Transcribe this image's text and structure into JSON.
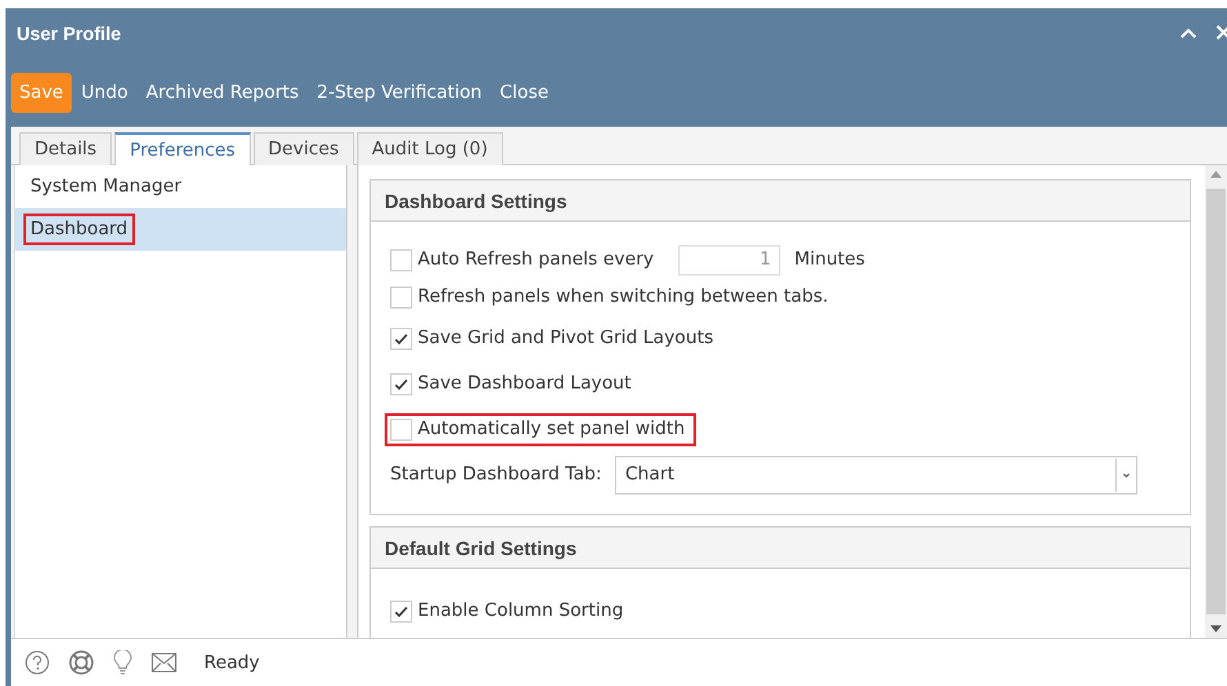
{
  "window": {
    "title": "User Profile"
  },
  "toolbar": [
    {
      "label": "Save",
      "kind": "primary"
    },
    {
      "label": "Undo",
      "kind": "plain"
    },
    {
      "label": "Archived Reports",
      "kind": "plain"
    },
    {
      "label": "2-Step Verification",
      "kind": "plain"
    },
    {
      "label": "Close",
      "kind": "plain"
    }
  ],
  "tabs": [
    {
      "label": "Details",
      "selected": false
    },
    {
      "label": "Preferences",
      "selected": true
    },
    {
      "label": "Devices",
      "selected": false
    },
    {
      "label": "Audit Log (0)",
      "selected": false
    }
  ],
  "sidebar": {
    "items": [
      {
        "label": "System Manager",
        "selected": false,
        "highlighted": false
      },
      {
        "label": "Dashboard",
        "selected": true,
        "highlighted": true
      }
    ]
  },
  "sections": [
    {
      "title": "Dashboard Settings",
      "rows": [
        {
          "kind": "checkbox-number",
          "label": "Auto Refresh panels every",
          "checked": false,
          "value": "1",
          "unit": "Minutes",
          "highlighted": false
        },
        {
          "kind": "checkbox",
          "label": "Refresh panels when switching between tabs.",
          "checked": false,
          "highlighted": false
        },
        {
          "kind": "checkbox",
          "label": "Save Grid and Pivot Grid Layouts",
          "checked": true,
          "highlighted": false
        },
        {
          "kind": "checkbox",
          "label": "Save Dashboard Layout",
          "checked": true,
          "highlighted": false
        },
        {
          "kind": "checkbox",
          "label": "Automatically set panel width",
          "checked": false,
          "highlighted": true
        },
        {
          "kind": "dropdown",
          "label": "Startup Dashboard Tab:",
          "value": "Chart"
        }
      ]
    },
    {
      "title": "Default Grid Settings",
      "rows": [
        {
          "kind": "checkbox",
          "label": "Enable Column Sorting",
          "checked": true,
          "highlighted": false
        }
      ]
    }
  ],
  "status_bar": {
    "text": "Ready"
  }
}
